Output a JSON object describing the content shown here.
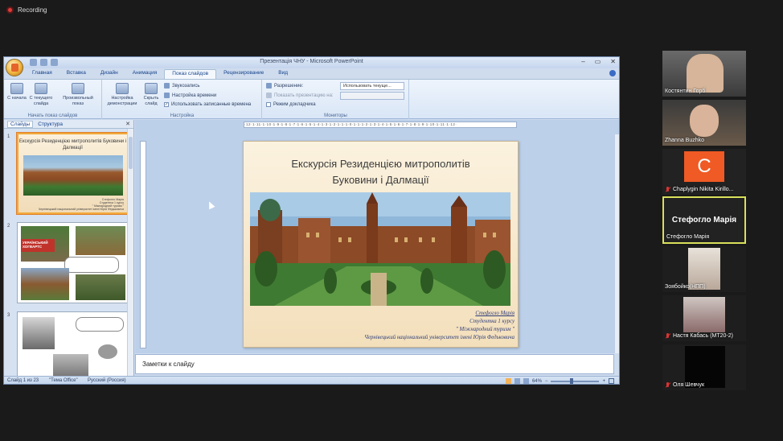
{
  "recording": {
    "label": "Recording"
  },
  "window": {
    "title": "Презентація ЧНУ - Microsoft PowerPoint",
    "controls": {
      "minimize": "–",
      "restore": "▭",
      "close": "✕"
    }
  },
  "ribbon_tabs": [
    {
      "label": "Главная"
    },
    {
      "label": "Вставка"
    },
    {
      "label": "Дизайн"
    },
    {
      "label": "Анимация"
    },
    {
      "label": "Показ слайдов",
      "active": true
    },
    {
      "label": "Рецензирование"
    },
    {
      "label": "Вид"
    }
  ],
  "ribbon": {
    "group_start": {
      "label": "Начать показ слайдов",
      "btn_from_start": "С начала",
      "btn_from_current": "С текущего слайда",
      "btn_custom": "Произвольный показ"
    },
    "group_setup": {
      "label": "Настройка",
      "btn_setup": "Настройка демонстрации",
      "btn_hide": "Скрыть слайд",
      "record_narration": "Звукозапись",
      "rehearse_timings": "Настройка времени",
      "use_timings": "Использовать записанные времена"
    },
    "group_monitors": {
      "label": "Мониторы",
      "resolution_label": "Разрешение:",
      "resolution_value": "Использовать текуще...",
      "show_on_label": "Показать презентацию на:",
      "presenter_view": "Режим докладчика"
    }
  },
  "left_pane": {
    "tab_slides": "Слайды",
    "tab_outline": "Структура",
    "close": "✕",
    "thumbnails": [
      {
        "number": "1",
        "title": "Екскурсія  Резиденцією митрополитів Буковини і Далмації"
      },
      {
        "number": "2",
        "label": "УКРАЇНСЬКИЙ ХОГВАРТС"
      },
      {
        "number": "3"
      }
    ]
  },
  "ruler": {
    "marks": "·12·1·11·1·10·1·9·1·8·1·7·1·6·1·5·1·4·1·3·1·2·1·1·1·0·1·1·1·2·1·3·1·4·1·5·1·6·1·7·1·8·1·9·1·10·1·11·1·12·"
  },
  "slide": {
    "title_line1": "Екскурсія  Резиденцією митрополитів",
    "title_line2": "Буковини і Далмації",
    "caption": {
      "author": "Стефогло Марія",
      "course": "Студентка 1 курсу",
      "program": "\" Міжнародний туризм \"",
      "university": "Чернівецький національний університет імені Юрія Федьковича"
    }
  },
  "notes": {
    "placeholder": "Заметки к слайду"
  },
  "status_bar": {
    "slide_info": "Слайд 1 из 23",
    "theme": "\"Тема Office\"",
    "language": "Русский (Россия)",
    "zoom": "64%"
  },
  "participants": [
    {
      "name": "Костянтин Горб",
      "muted": false
    },
    {
      "name": "Zhanna Buzhko",
      "muted": false
    },
    {
      "name": "Chaplygin Nikita Kirillo...",
      "muted": true,
      "avatar_letter": "C",
      "avatar_color": "#f05a24"
    },
    {
      "name": "Стефогло Марія",
      "muted": false,
      "active_speaker": true,
      "big_label": "Стефогло Марія"
    },
    {
      "name": "Зоябойко(НПП)",
      "muted": false
    },
    {
      "name": "Настя Кабась (МТ20-2)",
      "muted": true
    },
    {
      "name": "Оля Шевчук",
      "muted": true
    }
  ],
  "colors": {
    "active_speaker_border": "#d9e05a",
    "accent": "#15428b"
  }
}
